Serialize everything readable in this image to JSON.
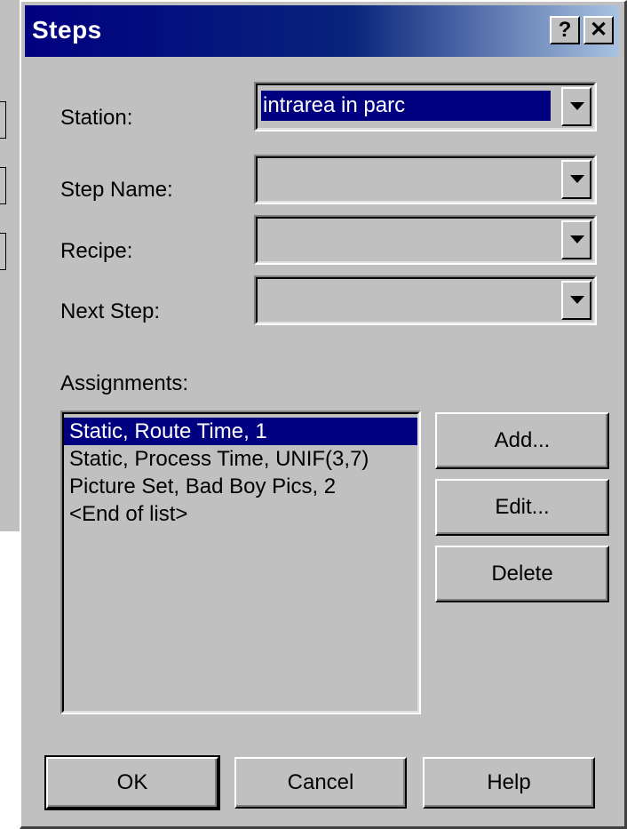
{
  "dialog": {
    "title": "Steps",
    "help_symbol": "?",
    "close_symbol": "✕"
  },
  "fields": {
    "station": {
      "label": "Station:",
      "value": "intrarea in parc"
    },
    "step_name": {
      "label": "Step Name:",
      "value": ""
    },
    "recipe": {
      "label": "Recipe:",
      "value": ""
    },
    "next_step": {
      "label": "Next Step:",
      "value": ""
    }
  },
  "assignments": {
    "label": "Assignments:",
    "items": [
      "Static, Route Time, 1",
      "Static, Process Time, UNIF(3,7)",
      "Picture Set, Bad Boy Pics, 2",
      "<End of list>"
    ],
    "selected_index": 0
  },
  "side_buttons": {
    "add": "Add...",
    "edit": "Edit...",
    "delete": "Delete"
  },
  "footer_buttons": {
    "ok": "OK",
    "cancel": "Cancel",
    "help": "Help"
  },
  "colors": {
    "title_bar": "#000080",
    "selection": "#000080",
    "face": "#c0c0c0"
  }
}
